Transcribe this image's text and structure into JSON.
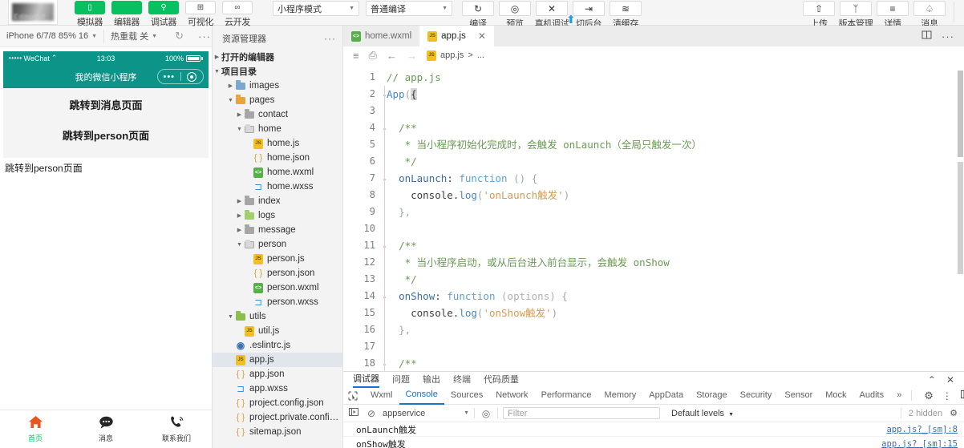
{
  "toolbar": {
    "logo_alt": "project-logo",
    "nav_buttons": [
      {
        "label": "模拟器",
        "icon": "phone-icon",
        "style": "green",
        "glyph": "▯"
      },
      {
        "label": "编辑器",
        "icon": "code-icon",
        "style": "green",
        "glyph": "</>"
      },
      {
        "label": "调试器",
        "icon": "debug-icon",
        "style": "green",
        "glyph": "⚲"
      },
      {
        "label": "可视化",
        "icon": "layout-icon",
        "style": "white",
        "glyph": "⊞"
      },
      {
        "label": "云开发",
        "icon": "cloud-icon",
        "style": "white",
        "glyph": "∞"
      }
    ],
    "mode_select": "小程序模式",
    "compile_select": "普通编译",
    "action_buttons": [
      {
        "label": "编译",
        "icon": "refresh-icon",
        "glyph": "↻"
      },
      {
        "label": "预览",
        "icon": "eye-icon",
        "glyph": "◎"
      },
      {
        "label": "真机调试",
        "icon": "device-debug-icon",
        "glyph": "✕"
      },
      {
        "label": "切后台",
        "icon": "background-icon",
        "glyph": "⇥"
      },
      {
        "label": "清缓存",
        "icon": "layers-icon",
        "glyph": "≋"
      }
    ],
    "right_buttons": [
      {
        "label": "上传",
        "icon": "upload-icon",
        "glyph": "⇧"
      },
      {
        "label": "版本管理",
        "icon": "branch-icon",
        "glyph": "ᛉ"
      },
      {
        "label": "详情",
        "icon": "menu-icon",
        "glyph": "≡"
      },
      {
        "label": "消息",
        "icon": "bell-icon",
        "glyph": "♤"
      }
    ]
  },
  "simulator": {
    "device_select": "iPhone 6/7/8 85% 16",
    "hotreload_select": "热重载 关",
    "refresh_icon": "refresh-icon",
    "more_icon": "more-dots-icon",
    "status_bar": {
      "dots": "•••••",
      "carrier": "WeChat",
      "wifi": "⌃",
      "time": "13:03",
      "battery": "100%"
    },
    "nav_title": "我的微信小程序",
    "page_buttons": [
      "跳转到消息页面",
      "跳转到person页面"
    ],
    "outside_text": "跳转到person页面",
    "tabbar": [
      {
        "label": "首页",
        "icon": "home-icon",
        "glyph": "⌂",
        "color": "#e8551f",
        "active": true
      },
      {
        "label": "消息",
        "icon": "chat-icon",
        "glyph": "●",
        "color": "#262626",
        "active": false
      },
      {
        "label": "联系我们",
        "icon": "phone-call-icon",
        "glyph": "✆",
        "color": "#262626",
        "active": false
      }
    ]
  },
  "explorer": {
    "title": "资源管理器",
    "more_icon": "more-dots-icon",
    "toolbar_icons": [
      "new-file-icon",
      "search-icon",
      "source-control-icon",
      "extensions-icon",
      "split-icon",
      "debug-console-icon"
    ],
    "sections": [
      {
        "label": "打开的编辑器",
        "expanded": false,
        "indent": 0,
        "kind": "section"
      },
      {
        "label": "项目目录",
        "expanded": true,
        "indent": 0,
        "kind": "section"
      }
    ],
    "tree": [
      {
        "label": "images",
        "kind": "folder",
        "color": "blue",
        "indent": 1,
        "expanded": false
      },
      {
        "label": "pages",
        "kind": "folder",
        "color": "orange",
        "indent": 1,
        "expanded": true
      },
      {
        "label": "contact",
        "kind": "folder",
        "color": "gray",
        "indent": 2,
        "expanded": false
      },
      {
        "label": "home",
        "kind": "folder",
        "color": "open",
        "indent": 2,
        "expanded": true
      },
      {
        "label": "home.js",
        "kind": "js",
        "indent": 3
      },
      {
        "label": "home.json",
        "kind": "json",
        "indent": 3
      },
      {
        "label": "home.wxml",
        "kind": "wxml",
        "indent": 3
      },
      {
        "label": "home.wxss",
        "kind": "wxss",
        "indent": 3
      },
      {
        "label": "index",
        "kind": "folder",
        "color": "gray",
        "indent": 2,
        "expanded": false
      },
      {
        "label": "logs",
        "kind": "folder",
        "color": "ltgreen",
        "indent": 2,
        "expanded": false
      },
      {
        "label": "message",
        "kind": "folder",
        "color": "gray",
        "indent": 2,
        "expanded": false
      },
      {
        "label": "person",
        "kind": "folder",
        "color": "open",
        "indent": 2,
        "expanded": true
      },
      {
        "label": "person.js",
        "kind": "js",
        "indent": 3
      },
      {
        "label": "person.json",
        "kind": "json",
        "indent": 3
      },
      {
        "label": "person.wxml",
        "kind": "wxml",
        "indent": 3
      },
      {
        "label": "person.wxss",
        "kind": "wxss",
        "indent": 3
      },
      {
        "label": "utils",
        "kind": "folder",
        "color": "green",
        "indent": 1,
        "expanded": true
      },
      {
        "label": "util.js",
        "kind": "js",
        "indent": 2
      },
      {
        "label": ".eslintrc.js",
        "kind": "eslint",
        "indent": 1
      },
      {
        "label": "app.js",
        "kind": "js",
        "indent": 1,
        "selected": true
      },
      {
        "label": "app.json",
        "kind": "json",
        "indent": 1
      },
      {
        "label": "app.wxss",
        "kind": "wxss",
        "indent": 1
      },
      {
        "label": "project.config.json",
        "kind": "json",
        "indent": 1
      },
      {
        "label": "project.private.config.js...",
        "kind": "json",
        "indent": 1
      },
      {
        "label": "sitemap.json",
        "kind": "json",
        "indent": 1
      }
    ]
  },
  "editor": {
    "tabs": [
      {
        "label": "home.wxml",
        "kind": "wxml",
        "active": false,
        "closable": false
      },
      {
        "label": "app.js",
        "kind": "js",
        "active": true,
        "closable": true,
        "close_icon": "close-icon"
      }
    ],
    "right_icons": [
      "split-editor-icon",
      "more-dots-icon"
    ],
    "breadcrumb_icons": [
      "outline-icon",
      "bookmark-icon",
      "back-arrow-icon",
      "forward-arrow-icon"
    ],
    "breadcrumb": {
      "file": "app.js",
      "separator": ">",
      "tail": "..."
    },
    "lines": [
      {
        "n": 1,
        "fold": "",
        "html": "<span class='t-cmt'>// app.js</span>"
      },
      {
        "n": 2,
        "fold": "⌄",
        "html": "<span class='t-fn'>App</span><span class='t-punc'>(</span><span class='sel-box'>{</span>"
      },
      {
        "n": 3,
        "fold": "",
        "html": ""
      },
      {
        "n": 4,
        "fold": "⌄",
        "html": "  <span class='t-cmt'>/**</span>"
      },
      {
        "n": 5,
        "fold": "",
        "html": "   <span class='t-cmt'>* 当小程序初始化完成时，会触发 onLaunch（全局只触发一次）</span>"
      },
      {
        "n": 6,
        "fold": "",
        "html": "   <span class='t-cmt'>*/</span>"
      },
      {
        "n": 7,
        "fold": "⌄",
        "html": "  <span class='t-prop'>onLaunch</span><span class='t-pl'>: </span><span class='t-kw'>function</span> <span class='t-punc'>()</span> <span class='t-punc'>{</span>"
      },
      {
        "n": 8,
        "fold": "",
        "html": "    <span class='t-pl'>console</span><span class='t-pl'>.</span><span class='t-fn'>log</span><span class='t-punc'>(</span><span class='t-str'>'onLaunch触发'</span><span class='t-punc'>)</span>"
      },
      {
        "n": 9,
        "fold": "",
        "html": "  <span class='t-punc'>},</span>"
      },
      {
        "n": 10,
        "fold": "",
        "html": ""
      },
      {
        "n": 11,
        "fold": "⌄",
        "html": "  <span class='t-cmt'>/**</span>"
      },
      {
        "n": 12,
        "fold": "",
        "html": "   <span class='t-cmt'>* 当小程序启动，或从后台进入前台显示，会触发 onShow</span>"
      },
      {
        "n": 13,
        "fold": "",
        "html": "   <span class='t-cmt'>*/</span>"
      },
      {
        "n": 14,
        "fold": "⌄",
        "html": "  <span class='t-prop'>onShow</span><span class='t-pl'>: </span><span class='t-kw'>function</span> <span class='t-dim'>(options)</span> <span class='t-punc'>{</span>"
      },
      {
        "n": 15,
        "fold": "",
        "html": "    <span class='t-pl'>console</span><span class='t-pl'>.</span><span class='t-fn'>log</span><span class='t-punc'>(</span><span class='t-str'>'onShow触发'</span><span class='t-punc'>)</span>"
      },
      {
        "n": 16,
        "fold": "",
        "html": "  <span class='t-punc'>},</span>"
      },
      {
        "n": 17,
        "fold": "",
        "html": ""
      },
      {
        "n": 18,
        "fold": "⌄",
        "html": "  <span class='t-cmt'>/**</span>"
      }
    ]
  },
  "debugger": {
    "panel_tabs": [
      {
        "label": "调试器",
        "active": true
      },
      {
        "label": "问题",
        "active": false
      },
      {
        "label": "输出",
        "active": false
      },
      {
        "label": "终端",
        "active": false
      },
      {
        "label": "代码质量",
        "active": false
      }
    ],
    "corner_icons": [
      "collapse-icon",
      "close-icon"
    ],
    "devtools_tabs": [
      {
        "label": "Wxml",
        "active": false
      },
      {
        "label": "Console",
        "active": true
      },
      {
        "label": "Sources",
        "active": false
      },
      {
        "label": "Network",
        "active": false
      },
      {
        "label": "Performance",
        "active": false
      },
      {
        "label": "Memory",
        "active": false
      },
      {
        "label": "AppData",
        "active": false
      },
      {
        "label": "Storage",
        "active": false
      },
      {
        "label": "Security",
        "active": false
      },
      {
        "label": "Sensor",
        "active": false
      },
      {
        "label": "Mock",
        "active": false
      },
      {
        "label": "Audits",
        "active": false
      }
    ],
    "overflow_icon": "chevron-double-right-icon",
    "devtools_right_icons": [
      "gear-icon",
      "kebab-menu-icon",
      "dock-icon",
      "settings-icon"
    ],
    "cursor_select_icon": "inspect-cursor-icon",
    "console_toolbar": {
      "execute_icon": "execute-icon",
      "clear_icon": "clear-console-icon",
      "context": "appservice",
      "eye_icon": "eye-icon",
      "filter_placeholder": "Filter",
      "levels": "Default levels",
      "hidden_count": "2 hidden",
      "settings_icon": "gear-icon"
    },
    "console_rows": [
      {
        "message": "onLaunch触发",
        "source": "app.js?_[sm]:8"
      },
      {
        "message": "onShow触发",
        "source": "app.js?_[sm]:15"
      }
    ]
  },
  "colors": {
    "accent_green": "#07c160",
    "wechat_teal": "#0d9488",
    "devtools_blue": "#1a73c8",
    "tab_active_orange": "#e8551f"
  }
}
